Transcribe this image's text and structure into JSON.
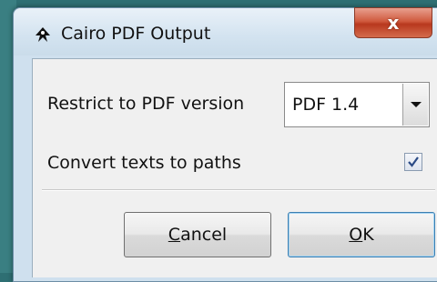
{
  "window": {
    "title": "Cairo PDF Output",
    "close_label": "x",
    "app_icon": "inkscape-icon"
  },
  "form": {
    "pdf_version_label": "Restrict to PDF version",
    "pdf_version_value": "PDF 1.4",
    "convert_texts_label": "Convert texts to paths",
    "convert_texts_checked": true
  },
  "buttons": {
    "cancel": {
      "mnemonic": "C",
      "rest": "ancel"
    },
    "ok": {
      "mnemonic": "O",
      "rest": "K"
    }
  },
  "colors": {
    "desktop": "#2e6f73",
    "close_button": "#c9472b",
    "checkmark": "#2a4a86"
  }
}
